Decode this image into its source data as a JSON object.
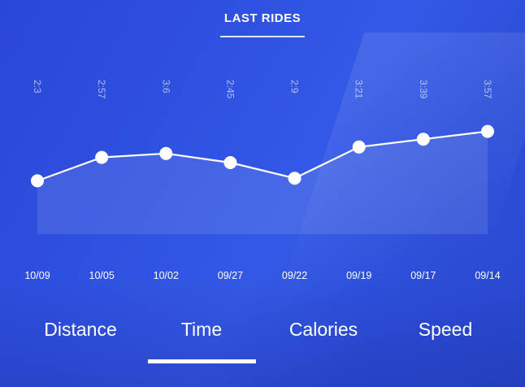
{
  "header": {
    "title": "LAST RIDES"
  },
  "chart_data": {
    "type": "line",
    "x": [
      "10/09",
      "10/05",
      "10/02",
      "09/27",
      "09/22",
      "09/19",
      "09/17",
      "09/14"
    ],
    "point_labels": [
      "2:3",
      "2:57",
      "3:6",
      "2:45",
      "2:9",
      "3:21",
      "3:39",
      "3:57"
    ],
    "values": [
      2.05,
      2.95,
      3.1,
      2.75,
      2.15,
      3.35,
      3.65,
      3.95
    ],
    "title": "",
    "xlabel": "",
    "ylabel": "",
    "ylim": [
      0,
      9
    ],
    "grid": false,
    "line_color": "#ffffff",
    "area_fill": "rgba(255,255,255,0.10)"
  },
  "tabs": [
    {
      "label": "Distance"
    },
    {
      "label": "Time"
    },
    {
      "label": "Calories"
    },
    {
      "label": "Speed"
    }
  ],
  "selected_tab": "Time",
  "colors": {
    "background": "#2f52e0",
    "accent": "#ffffff"
  }
}
